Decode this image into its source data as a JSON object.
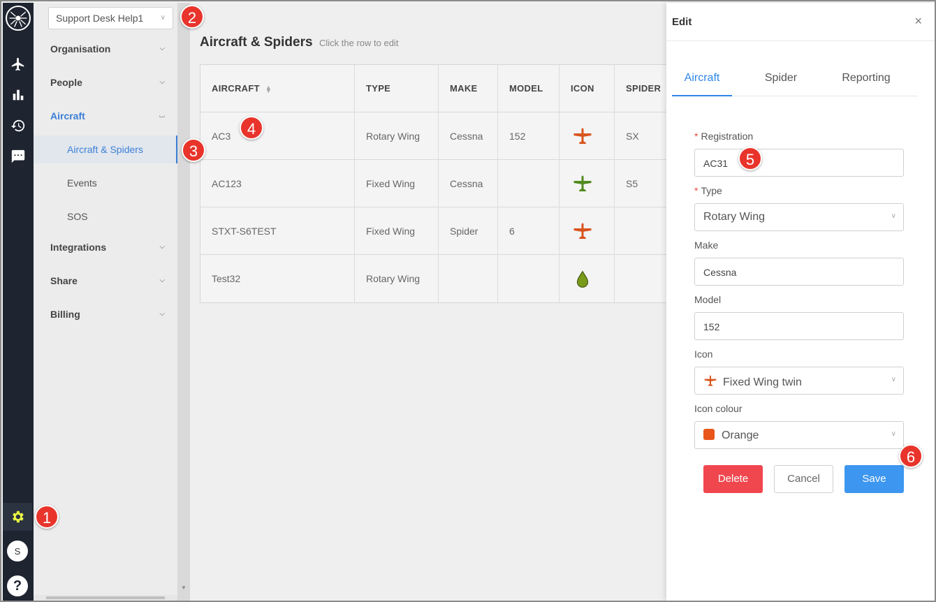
{
  "org_selector": {
    "value": "Support Desk Help1"
  },
  "user": {
    "avatar_initial": "S"
  },
  "help": {
    "label": "?"
  },
  "sidebar": {
    "items": [
      {
        "label": "Organisation",
        "expanded": false
      },
      {
        "label": "People",
        "expanded": false
      },
      {
        "label": "Aircraft",
        "expanded": true,
        "active": true
      },
      {
        "label": "Integrations",
        "expanded": false
      },
      {
        "label": "Share",
        "expanded": false
      },
      {
        "label": "Billing",
        "expanded": false
      }
    ],
    "aircraft_sub": [
      {
        "label": "Aircraft & Spiders",
        "selected": true
      },
      {
        "label": "Events"
      },
      {
        "label": "SOS"
      }
    ]
  },
  "main": {
    "title": "Aircraft & Spiders",
    "hint": "Click the row to edit",
    "table": {
      "columns": [
        "AIRCRAFT",
        "TYPE",
        "MAKE",
        "MODEL",
        "ICON",
        "SPIDER"
      ],
      "rows": [
        {
          "aircraft": "AC3",
          "type": "Rotary Wing",
          "make": "Cessna",
          "model": "152",
          "icon": "plane-icon",
          "icon_color": "#d9541e",
          "spider": "SX"
        },
        {
          "aircraft": "AC123",
          "type": "Fixed Wing",
          "make": "Cessna",
          "model": "",
          "icon": "plane-icon",
          "icon_color": "#4f8a1e",
          "spider": "S5"
        },
        {
          "aircraft": "STXT-S6TEST",
          "type": "Fixed Wing",
          "make": "Spider",
          "model": "6",
          "icon": "plane-icon",
          "icon_color": "#d9541e",
          "spider": ""
        },
        {
          "aircraft": "Test32",
          "type": "Rotary Wing",
          "make": "",
          "model": "",
          "icon": "drop-icon",
          "icon_color": "#7a9a1a",
          "spider": ""
        }
      ]
    }
  },
  "drawer": {
    "title": "Edit",
    "close": "×",
    "tabs": [
      {
        "label": "Aircraft",
        "active": true
      },
      {
        "label": "Spider"
      },
      {
        "label": "Reporting"
      }
    ],
    "form": {
      "registration_label": "Registration",
      "registration_value": "AC31",
      "type_label": "Type",
      "type_value": "Rotary Wing",
      "make_label": "Make",
      "make_value": "Cessna",
      "model_label": "Model",
      "model_value": "152",
      "icon_label": "Icon",
      "icon_value": "Fixed Wing twin",
      "icon_colour_label": "Icon colour",
      "icon_colour_value": "Orange",
      "icon_colour_hex": "#e8561a",
      "required_mark": "*"
    },
    "buttons": {
      "delete": "Delete",
      "cancel": "Cancel",
      "save": "Save"
    }
  },
  "markers": [
    "1",
    "2",
    "3",
    "4",
    "5",
    "6"
  ],
  "colors": {
    "accent": "#2f86e8",
    "rail": "#1e2430",
    "danger": "#f0474f",
    "save": "#3d96f0",
    "gear": "#e9f542"
  }
}
